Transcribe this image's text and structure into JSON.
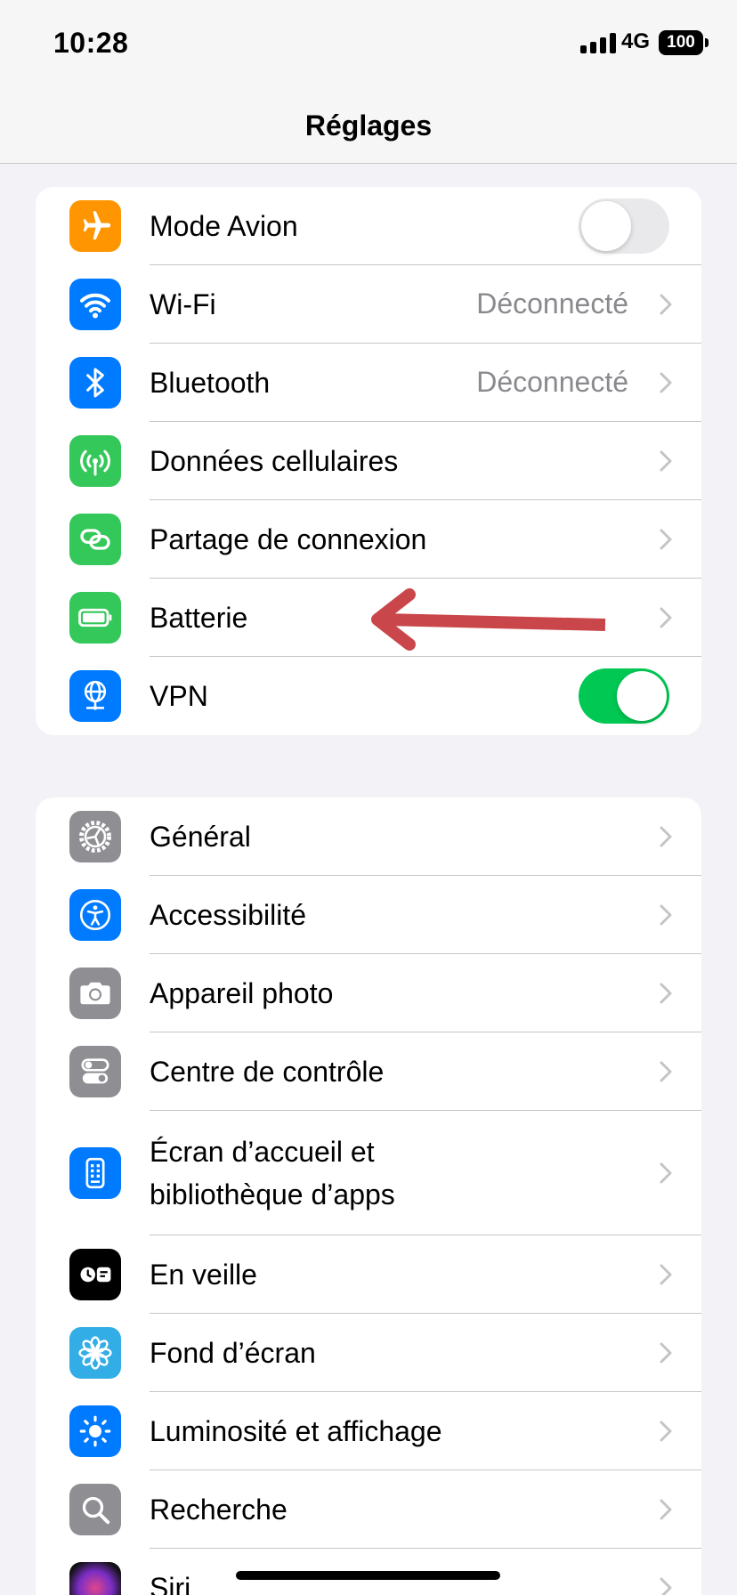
{
  "status_bar": {
    "time": "10:28",
    "network": "4G",
    "battery": "100"
  },
  "nav": {
    "title": "Réglages"
  },
  "colors": {
    "orange": "#ff9500",
    "blue": "#007aff",
    "green": "#34c759",
    "gray": "#8e8e93",
    "black": "#000000",
    "cyan": "#32ade6",
    "toggle_on": "#00c853",
    "arrow": "#c9474a"
  },
  "group1": [
    {
      "icon": "airplane-icon",
      "label": "Mode Avion",
      "toggle": "off"
    },
    {
      "icon": "wifi-icon",
      "label": "Wi-Fi",
      "value": "Déconnecté"
    },
    {
      "icon": "bluetooth-icon",
      "label": "Bluetooth",
      "value": "Déconnecté"
    },
    {
      "icon": "antenna-icon",
      "label": "Données cellulaires"
    },
    {
      "icon": "link-icon",
      "label": "Partage de connexion"
    },
    {
      "icon": "battery-icon",
      "label": "Batterie"
    },
    {
      "icon": "globe-network-icon",
      "label": "VPN",
      "toggle": "on"
    }
  ],
  "group2": [
    {
      "icon": "gear-icon",
      "label": "Général"
    },
    {
      "icon": "accessibility-icon",
      "label": "Accessibilité"
    },
    {
      "icon": "camera-icon",
      "label": "Appareil photo"
    },
    {
      "icon": "switches-icon",
      "label": "Centre de contrôle"
    },
    {
      "icon": "phone-grid-icon",
      "label": "Écran d’accueil et\nbibliothèque d’apps"
    },
    {
      "icon": "standby-icon",
      "label": "En veille"
    },
    {
      "icon": "flower-icon",
      "label": "Fond d’écran"
    },
    {
      "icon": "sun-icon",
      "label": "Luminosité et affichage"
    },
    {
      "icon": "magnifier-icon",
      "label": "Recherche"
    },
    {
      "icon": "siri-icon",
      "label": "Siri"
    }
  ]
}
